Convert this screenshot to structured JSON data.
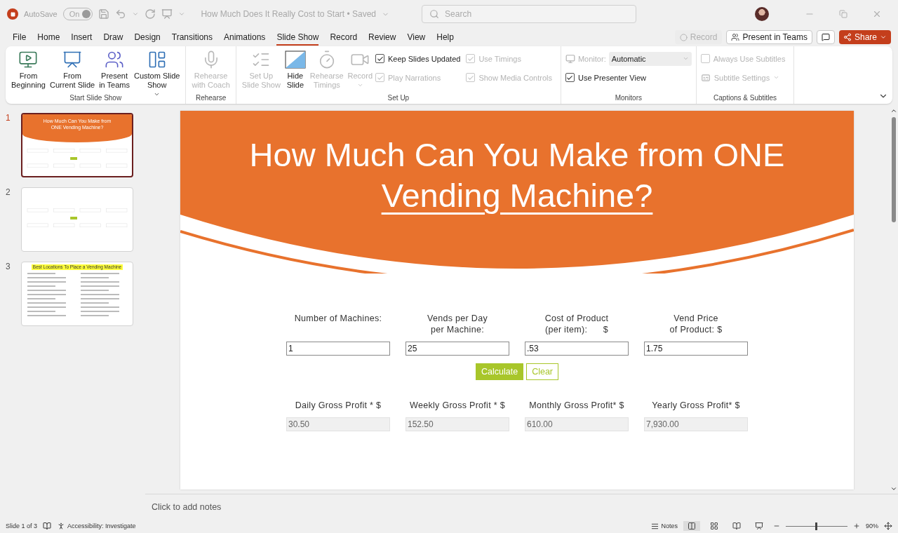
{
  "title_bar": {
    "autosave_label": "AutoSave",
    "autosave": {
      "label": "On",
      "on": true
    },
    "document_title": "How Much Does It Really Cost to Start • Saved",
    "search": {
      "placeholder": "Search"
    }
  },
  "menu_tabs": [
    {
      "label": "File",
      "selected": false
    },
    {
      "label": "Home",
      "selected": false
    },
    {
      "label": "Insert",
      "selected": false
    },
    {
      "label": "Draw",
      "selected": false
    },
    {
      "label": "Design",
      "selected": false
    },
    {
      "label": "Transitions",
      "selected": false
    },
    {
      "label": "Animations",
      "selected": false
    },
    {
      "label": "Slide Show",
      "selected": true
    },
    {
      "label": "Record",
      "selected": false
    },
    {
      "label": "Review",
      "selected": false
    },
    {
      "label": "View",
      "selected": false
    },
    {
      "label": "Help",
      "selected": false
    }
  ],
  "top_actions": {
    "record": {
      "label": "Record",
      "disabled": true
    },
    "present": {
      "label": "Present in Teams"
    },
    "share": {
      "label": "Share"
    }
  },
  "ribbon": {
    "groups": [
      {
        "label": "Start Slide Show",
        "items": [
          {
            "kind": "large",
            "label": "From\nBeginning",
            "disabled": false,
            "dropdown": false
          },
          {
            "kind": "large",
            "label": "From\nCurrent Slide",
            "disabled": false,
            "dropdown": false
          },
          {
            "kind": "large",
            "label": "Present\nin Teams",
            "disabled": false,
            "dropdown": false
          },
          {
            "kind": "large",
            "label": "Custom Slide\nShow",
            "disabled": false,
            "dropdown": true
          }
        ]
      },
      {
        "label": "Rehearse",
        "items": [
          {
            "kind": "large",
            "label": "Rehearse\nwith Coach",
            "disabled": true,
            "dropdown": false
          }
        ]
      },
      {
        "label": "Set Up",
        "items": [
          {
            "kind": "large",
            "label": "Set Up\nSlide Show",
            "disabled": true,
            "dropdown": false
          },
          {
            "kind": "large",
            "label": "Hide\nSlide",
            "disabled": false,
            "dropdown": false
          },
          {
            "kind": "large",
            "label": "Rehearse\nTimings",
            "disabled": true,
            "dropdown": false
          },
          {
            "kind": "large",
            "label": "Record",
            "disabled": true,
            "dropdown": true
          },
          {
            "kind": "check",
            "label": "Keep Slides Updated",
            "checked": true,
            "disabled": false
          },
          {
            "kind": "check",
            "label": "Play Narrations",
            "checked": true,
            "disabled": true
          },
          {
            "kind": "check",
            "label": "Use Timings",
            "checked": true,
            "disabled": true
          },
          {
            "kind": "check",
            "label": "Show Media Controls",
            "checked": true,
            "disabled": true
          }
        ]
      },
      {
        "label": "Monitors",
        "items": [
          {
            "kind": "select",
            "label": "Monitor:",
            "value": "Automatic",
            "disabled": true
          },
          {
            "kind": "check",
            "label": "Use Presenter View",
            "checked": true,
            "disabled": false
          }
        ]
      },
      {
        "label": "Captions & Subtitles",
        "items": [
          {
            "kind": "check",
            "label": "Always Use Subtitles",
            "checked": false,
            "disabled": true
          },
          {
            "kind": "menu",
            "label": "Subtitle Settings",
            "disabled": true
          }
        ]
      }
    ]
  },
  "thumbnails": [
    {
      "number": "1",
      "selected": true,
      "kind": "calculator",
      "title": "How Much Can You Make from ONE Vending Machine?"
    },
    {
      "number": "2",
      "selected": false,
      "kind": "calculator_plain"
    },
    {
      "number": "3",
      "selected": false,
      "kind": "list",
      "title": "Best Locations To Place a Vending Machine"
    }
  ],
  "slide": {
    "title_lines": [
      "How Much Can You Make from ONE",
      "Vending Machine?"
    ],
    "inputs": [
      {
        "label": "Number of Machines:",
        "value": "1"
      },
      {
        "label": "Vends per Day\nper Machine:",
        "value": "25"
      },
      {
        "label": "Cost of Product\n(per item):      $",
        "value": ".53"
      },
      {
        "label": "Vend Price\nof Product: $",
        "value": "1.75"
      }
    ],
    "buttons": [
      {
        "label": "Calculate",
        "kind": "primary"
      },
      {
        "label": "Clear",
        "kind": "outline"
      }
    ],
    "results": [
      {
        "label": "Daily Gross Profit * $",
        "value": "30.50"
      },
      {
        "label": "Weekly Gross Profit * $",
        "value": "152.50"
      },
      {
        "label": "Monthly Gross Profit* $",
        "value": "610.00"
      },
      {
        "label": "Yearly Gross Profit* $",
        "value": "7,930.00"
      }
    ]
  },
  "notes": {
    "placeholder": "Click to add notes"
  },
  "status_bar": {
    "slide_counter": "Slide 1 of 3",
    "accessibility": "Accessibility: Investigate",
    "notes": "Notes",
    "zoom": {
      "label": "90%",
      "level": 0.49
    }
  }
}
